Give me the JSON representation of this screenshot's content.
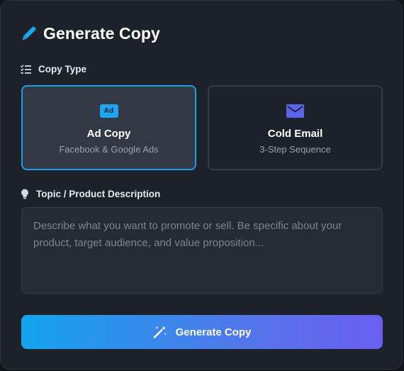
{
  "header": {
    "title": "Generate Copy",
    "icon": "pencil-icon"
  },
  "copy_type": {
    "label": "Copy Type",
    "icon": "checklist-icon",
    "options": [
      {
        "title": "Ad Copy",
        "subtitle": "Facebook & Google Ads",
        "icon": "ad-icon",
        "badge_text": "Ad",
        "selected": true
      },
      {
        "title": "Cold Email",
        "subtitle": "3-Step Sequence",
        "icon": "envelope-icon",
        "selected": false
      }
    ]
  },
  "topic": {
    "label": "Topic / Product Description",
    "icon": "lightbulb-icon",
    "placeholder": "Describe what you want to promote or sell. Be specific about your product, target audience, and value proposition...",
    "value": ""
  },
  "generate_button": {
    "label": "Generate Copy",
    "icon": "magic-wand-icon"
  },
  "colors": {
    "accent": "#1a9ee6",
    "gradient_start": "#13a4ec",
    "gradient_end": "#6a5ef0",
    "envelope": "#5b63e8",
    "panel_bg": "#1d222a"
  }
}
